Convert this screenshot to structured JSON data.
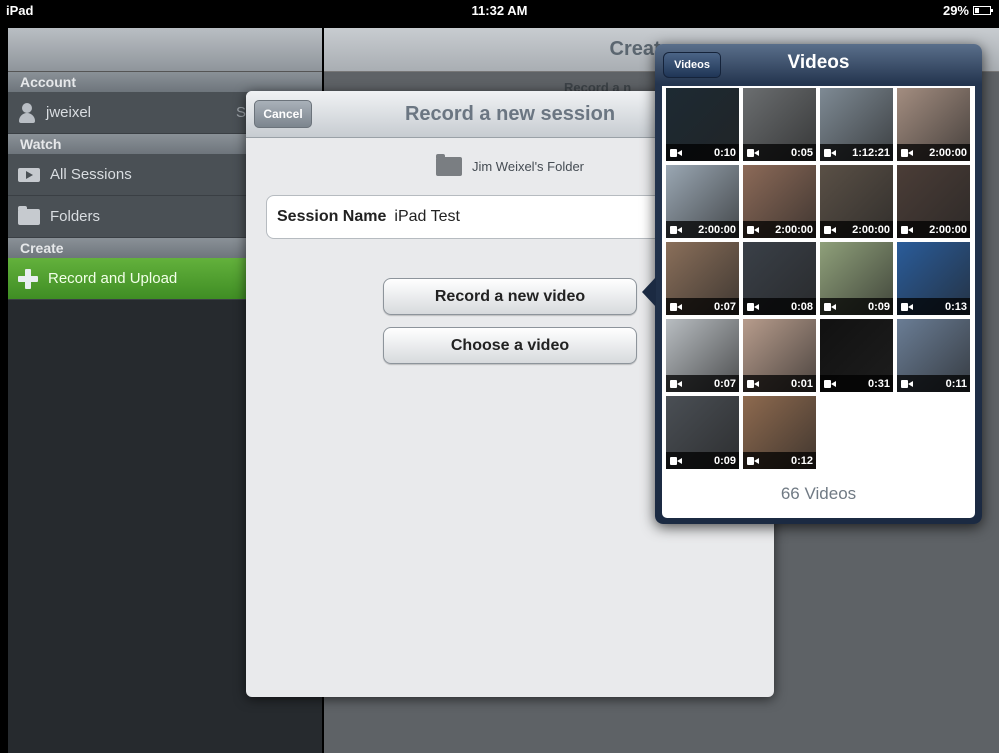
{
  "status_bar": {
    "device": "iPad",
    "time": "11:32 AM",
    "battery": "29%"
  },
  "sidebar": {
    "sections": [
      {
        "header": "Account"
      },
      {
        "header": "Watch"
      },
      {
        "header": "Create"
      }
    ],
    "user": {
      "name": "jweixel",
      "extra": "S"
    },
    "items": [
      {
        "label": "All Sessions",
        "icon": "play-icon"
      },
      {
        "label": "Folders",
        "icon": "folder-icon"
      },
      {
        "label": "Record and Upload",
        "icon": "plus-icon"
      }
    ]
  },
  "main": {
    "title": "Create a",
    "subtitle": "Record a n"
  },
  "modal": {
    "title": "Record a new session",
    "cancel_label": "Cancel",
    "folder_name": "Jim Weixel's Folder",
    "session_name_label": "Session Name",
    "session_name_value": "iPad Test",
    "record_button": "Record a new video",
    "choose_button": "Choose a video"
  },
  "popover": {
    "back_label": "Videos",
    "title": "Videos",
    "count_label": "66 Videos",
    "videos": [
      {
        "duration": "0:10",
        "bg": "#1d2a33"
      },
      {
        "duration": "0:05",
        "bg": "#6b6e70"
      },
      {
        "duration": "1:12:21",
        "bg": "#7e8a94"
      },
      {
        "duration": "2:00:00",
        "bg": "#a38d80"
      },
      {
        "duration": "2:00:00",
        "bg": "#9aa7b3"
      },
      {
        "duration": "2:00:00",
        "bg": "#8c6a58"
      },
      {
        "duration": "2:00:00",
        "bg": "#5a5046"
      },
      {
        "duration": "2:00:00",
        "bg": "#4b3d37"
      },
      {
        "duration": "0:07",
        "bg": "#8a6f5a"
      },
      {
        "duration": "0:08",
        "bg": "#3a4048"
      },
      {
        "duration": "0:09",
        "bg": "#8fa07a"
      },
      {
        "duration": "0:13",
        "bg": "#2a5c9a"
      },
      {
        "duration": "0:07",
        "bg": "#b8bdc1"
      },
      {
        "duration": "0:01",
        "bg": "#b79c8c"
      },
      {
        "duration": "0:31",
        "bg": "#111111"
      },
      {
        "duration": "0:11",
        "bg": "#6a7d95"
      },
      {
        "duration": "0:09",
        "bg": "#4a4f55"
      },
      {
        "duration": "0:12",
        "bg": "#8e6a4f"
      }
    ]
  }
}
